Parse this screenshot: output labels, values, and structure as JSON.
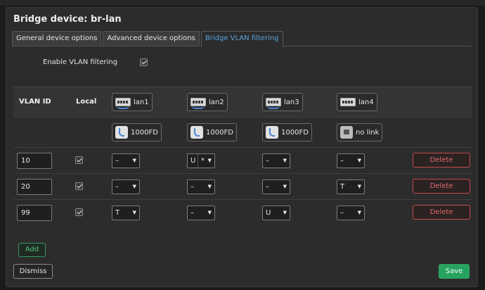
{
  "modal": {
    "title": "Bridge device: br-lan"
  },
  "tabs": [
    {
      "label": "General device options",
      "active": false
    },
    {
      "label": "Advanced device options",
      "active": false
    },
    {
      "label": "Bridge VLAN filtering",
      "active": true
    }
  ],
  "enable_vlan": {
    "label": "Enable VLAN filtering",
    "checked": true
  },
  "table": {
    "headers": {
      "vlan_id": "VLAN ID",
      "local": "Local"
    },
    "ports": [
      {
        "name": "lan1",
        "status": "1000FD"
      },
      {
        "name": "lan2",
        "status": "1000FD"
      },
      {
        "name": "lan3",
        "status": "1000FD"
      },
      {
        "name": "lan4",
        "status": "no link"
      }
    ],
    "rows": [
      {
        "vlan_id": "10",
        "local": true,
        "cells": [
          "–",
          "U",
          "–",
          "–"
        ],
        "lan2_extra": "*",
        "delete_label": "Delete"
      },
      {
        "vlan_id": "20",
        "local": true,
        "cells": [
          "–",
          "–",
          "–",
          "T"
        ],
        "delete_label": "Delete"
      },
      {
        "vlan_id": "99",
        "local": true,
        "cells": [
          "T",
          "–",
          "U",
          "–"
        ],
        "delete_label": "Delete"
      }
    ]
  },
  "buttons": {
    "add": "Add",
    "dismiss": "Dismiss",
    "save": "Save"
  },
  "colors": {
    "accent": "#5aa2dc",
    "danger": "#e26a6a",
    "success": "#26a35f"
  }
}
